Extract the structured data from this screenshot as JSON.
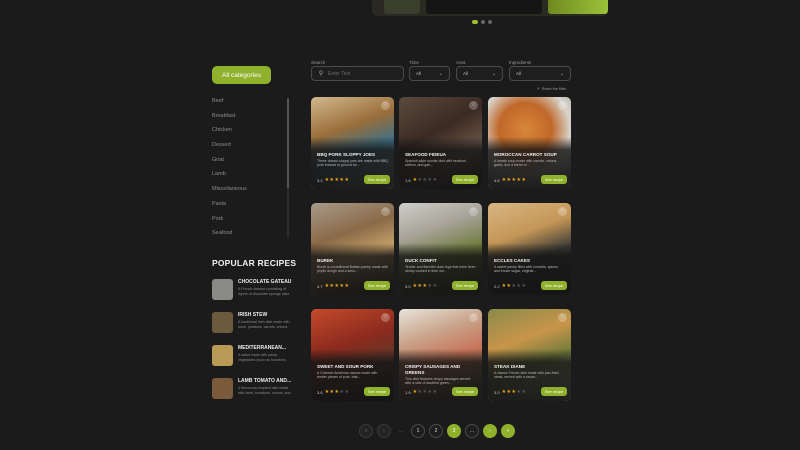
{
  "sidebar": {
    "all_categories_label": "All categories",
    "categories": [
      "Beef",
      "Breakfast",
      "Chicken",
      "Dessert",
      "Goat",
      "Lamb",
      "Miscellaneous",
      "Pasta",
      "Pork",
      "Seafood"
    ],
    "popular_title": "POPULAR RECIPES",
    "popular": [
      {
        "name": "CHOCOLATE GATEAU",
        "desc": "A French dessert consisting of layers of chocolate sponge cake and chocolate ganache,...",
        "color": "#8a8a86"
      },
      {
        "name": "IRISH STEW",
        "desc": "A traditional Irish dish made with lamb, potatoes, carrots, onions, and herbs, cooked in a thick a...",
        "color": "#6b5a3c"
      },
      {
        "name": "MEDITERRANEAN...",
        "desc": "A salad made with pasta, vegetables (such as tomatoes, cucumbers, and olives), feta...",
        "color": "#b89a56"
      },
      {
        "name": "LAMB TOMATO AND...",
        "desc": "A Moroccan-inspired dish made with lamb, tomatoes, onions, and spices (such as cinnamon,...",
        "color": "#7a5a3a"
      }
    ]
  },
  "filters": {
    "search_label": "Search",
    "search_placeholder": "Enter Text",
    "time_label": "Time",
    "time_value": "All",
    "area_label": "Area",
    "area_value": "All",
    "ingredients_label": "Ingredients",
    "ingredients_value": "All",
    "reset_label": "Reset the filter"
  },
  "cards": [
    {
      "title": "BBQ PORK SLOPPY JOES",
      "desc": "These classic sloppy joes are made with BBQ pork instead of ground be...",
      "rating": "3.2",
      "stars": 5,
      "button": "See recipe",
      "bg": "linear-gradient(160deg,#d2b88e 0%,#9a6e3a 35%,#3d6f86 60%,#c9c2b4 100%)"
    },
    {
      "title": "SEAFOOD FIDEUA",
      "desc": "Spanish-style noodle dish with seafood, saffron, and garl...",
      "rating": "1.8",
      "stars": 1,
      "button": "See recipe",
      "bg": "linear-gradient(150deg,#5a4a3e 0%,#3b2a22 40%,#6e5a4c 70%,#2c2626 100%)"
    },
    {
      "title": "MOROCCAN CARROT SOUP",
      "desc": "A hearty soup made with carrots, onions, garlic, and a blend of...",
      "rating": "4.6",
      "stars": 5,
      "button": "See recipe",
      "bg": "radial-gradient(circle at 45% 35%,#d9863a 0%,#c0682a 35%,#d8d4cc 60%,#9a9a96 100%)"
    },
    {
      "title": "BUREK",
      "desc": "Burek is a traditional Balkan pastry made with phyllo dough and a savo...",
      "rating": "4.7",
      "stars": 5,
      "button": "See recipe",
      "bg": "linear-gradient(160deg,#a89a8a 0%,#8a6a48 35%,#c9a46a 60%,#4a3a2a 100%)"
    },
    {
      "title": "DUCK CONFIT",
      "desc": "Tender and flavorful duck legs that have been slowly cooked in their ow...",
      "rating": "3.0",
      "stars": 3,
      "button": "See recipe",
      "bg": "linear-gradient(160deg,#cfcfc8 0%,#a8a49a 30%,#6e7a3a 60%,#3e4a24 100%)"
    },
    {
      "title": "ECCLES CAKES",
      "desc": "A sweet pastry filled with currants, spices, and brown sugar, originat...",
      "rating": "2.2",
      "stars": 2,
      "button": "See recipe",
      "bg": "linear-gradient(160deg,#d8b684 0%,#c49656 35%,#3a3a36 60%,#2a2a28 100%)"
    },
    {
      "title": "SWEET AND SOUR PORK",
      "desc": "A Chinese-American classic made with tender pieces of pork, batt...",
      "rating": "3.6",
      "stars": 3,
      "button": "See recipe",
      "bg": "linear-gradient(160deg,#c44a2a 0%,#8a2a1e 40%,#5a3a2a 70%,#2a2020 100%)"
    },
    {
      "title": "CRISPY SAUSAGES AND GREENS",
      "desc": "This dish features crispy sausages served with a side of sautéed green...",
      "rating": "1.9",
      "stars": 1,
      "button": "See recipe",
      "bg": "linear-gradient(160deg,#e8e4dc 0%,#c9a48a 30%,#c8745a 55%,#6e7a4a 100%)",
      "twoline": true
    },
    {
      "title": "STEAK DIANE",
      "desc": "A classic French dish made with pan-fried steak, served with a sauce...",
      "rating": "3.0",
      "stars": 3,
      "button": "See recipe",
      "bg": "linear-gradient(160deg,#8a8a4a 0%,#c8954a 35%,#6e7a3a 60%,#e0dcd2 100%)"
    }
  ],
  "pagination": {
    "first": "«",
    "prev": "‹",
    "ellipsis_start": "...",
    "pages": [
      "1",
      "2",
      "3"
    ],
    "active": "3",
    "ellipsis_end": "...",
    "next": "›",
    "last": "»"
  }
}
